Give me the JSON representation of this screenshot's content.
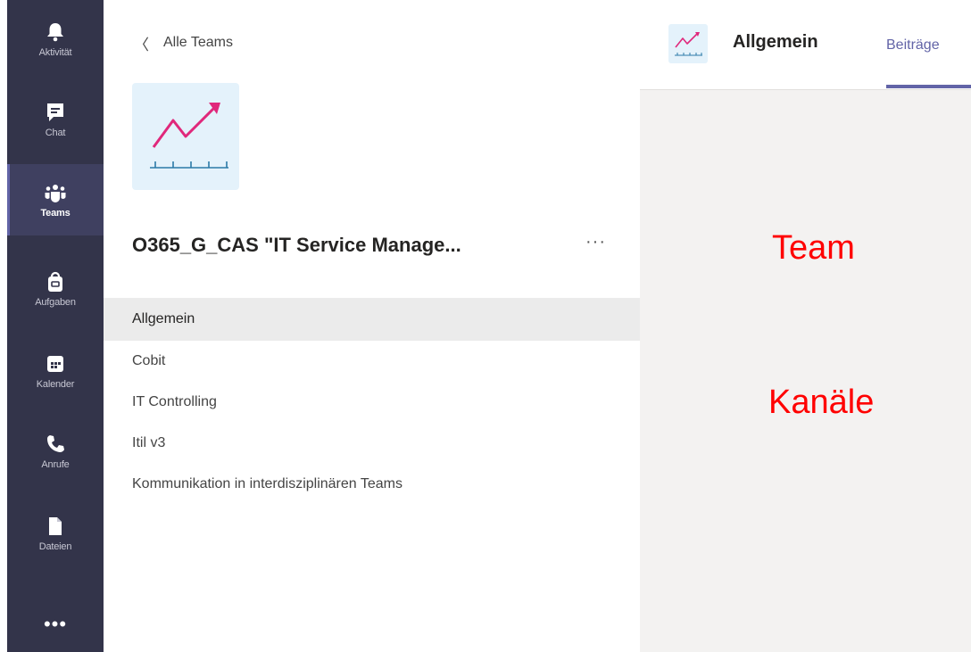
{
  "rail": {
    "items": [
      {
        "label": "Aktivität",
        "icon": "bell-icon"
      },
      {
        "label": "Chat",
        "icon": "chat-icon"
      },
      {
        "label": "Teams",
        "icon": "teams-icon",
        "active": true
      },
      {
        "label": "Aufgaben",
        "icon": "tasks-icon"
      },
      {
        "label": "Kalender",
        "icon": "calendar-icon"
      },
      {
        "label": "Anrufe",
        "icon": "phone-icon"
      },
      {
        "label": "Dateien",
        "icon": "files-icon"
      }
    ],
    "more_label": "•••"
  },
  "panel": {
    "back_label": "Alle Teams",
    "team_name": "O365_G_CAS \"IT Service Manage...",
    "more_label": "···",
    "channels": [
      {
        "label": "Allgemein",
        "active": true
      },
      {
        "label": "Cobit"
      },
      {
        "label": "IT Controlling"
      },
      {
        "label": "Itil v3"
      },
      {
        "label": "Kommunikation in interdisziplinären Teams"
      }
    ]
  },
  "main": {
    "title": "Allgemein",
    "tab": "Beiträge",
    "annotations": {
      "team": "Team",
      "channels": "Kanäle"
    }
  },
  "colors": {
    "rail_bg": "#33344a",
    "accent": "#6264a7",
    "logo_arrow": "#e0287b",
    "annotation": "#ff0000"
  }
}
